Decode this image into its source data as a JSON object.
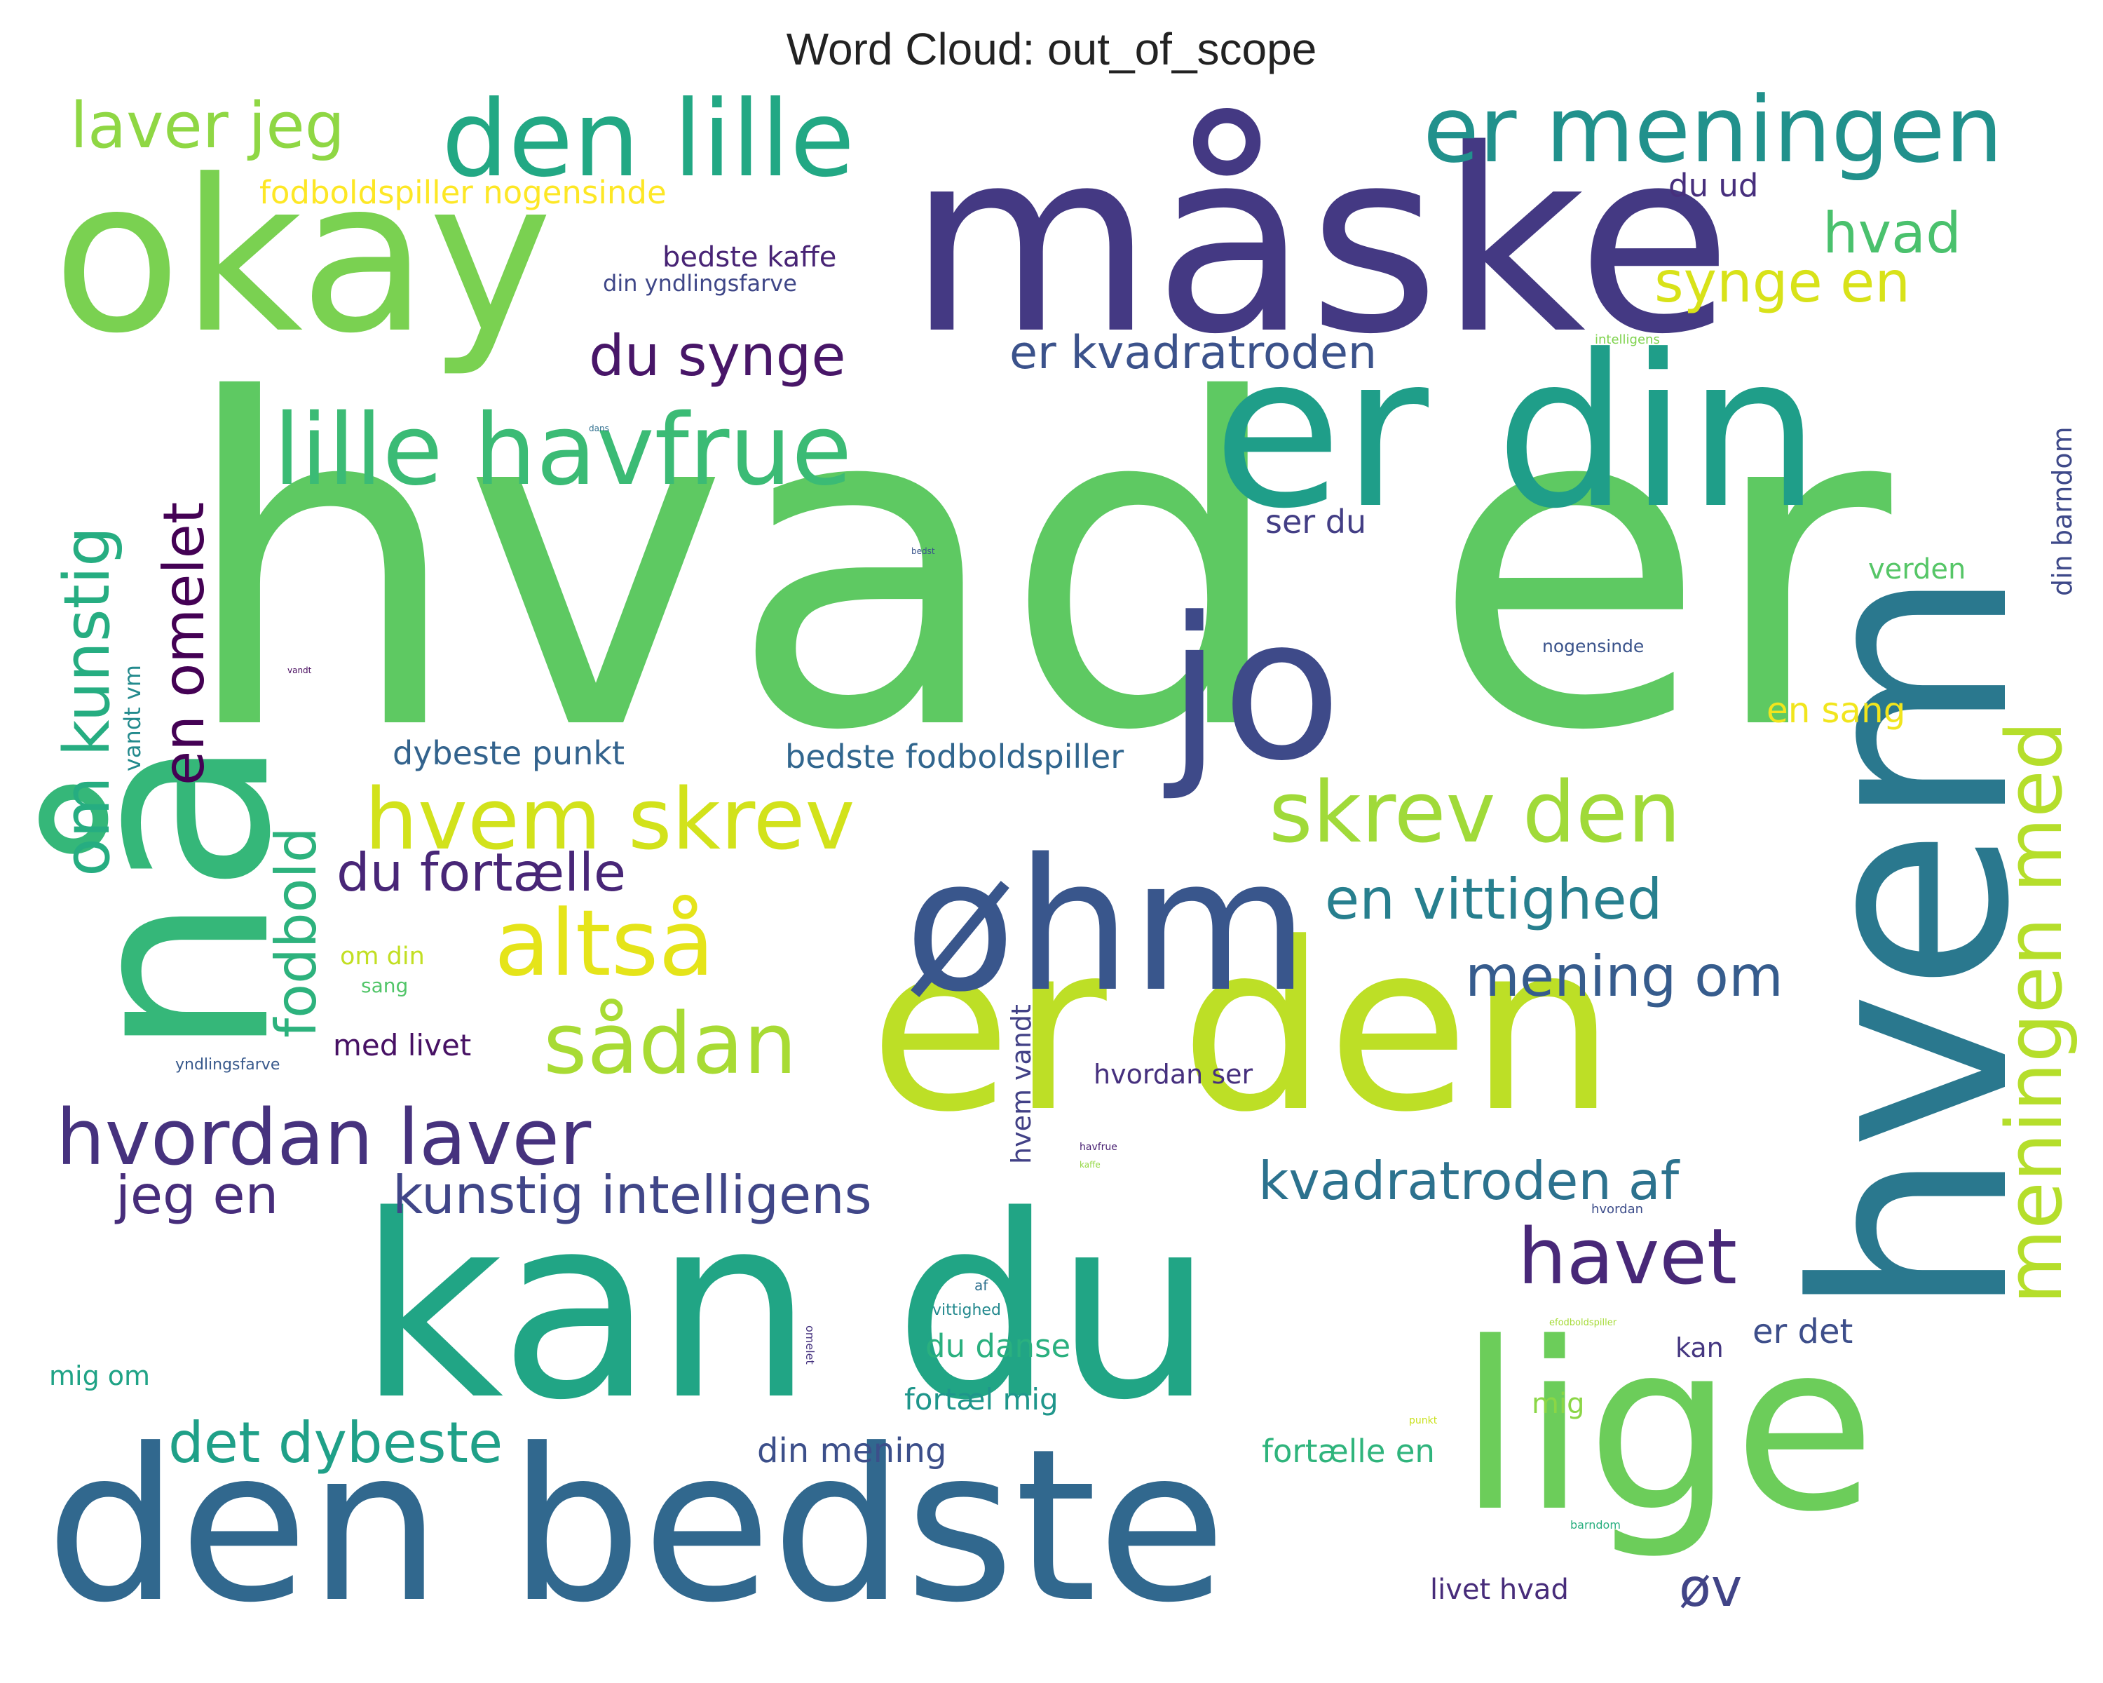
{
  "title": "Word Cloud: out_of_scope",
  "words": [
    {
      "text": "hvad er",
      "color": "#5ec962"
    },
    {
      "text": "måske",
      "color": "#443983"
    },
    {
      "text": "okay",
      "color": "#7ad151"
    },
    {
      "text": "er din",
      "color": "#1f9e89"
    },
    {
      "text": "kan du",
      "color": "#21a585"
    },
    {
      "text": "den bedste",
      "color": "#31688e"
    },
    {
      "text": "er den",
      "color": "#bddf26"
    },
    {
      "text": "hvem",
      "color": "#2a788e"
    },
    {
      "text": "lige",
      "color": "#6ccd5a"
    },
    {
      "text": "nå",
      "color": "#35b779"
    },
    {
      "text": "jo",
      "color": "#3e4a89"
    },
    {
      "text": "øhm",
      "color": "#39568c"
    },
    {
      "text": "den lille",
      "color": "#22a884"
    },
    {
      "text": "er meningen",
      "color": "#21918c"
    },
    {
      "text": "lille havfrue",
      "color": "#3bbb75"
    },
    {
      "text": "hvem skrev",
      "color": "#d2e21b"
    },
    {
      "text": "skrev den",
      "color": "#a0da39"
    },
    {
      "text": "altså",
      "color": "#e5e419"
    },
    {
      "text": "sådan",
      "color": "#a8db34"
    },
    {
      "text": "hvordan laver",
      "color": "#46327e"
    },
    {
      "text": "meningen med",
      "color": "#b5de2b"
    },
    {
      "text": "laver jeg",
      "color": "#8fd744"
    },
    {
      "text": "om kunstig",
      "color": "#26ad81"
    },
    {
      "text": "en omelet",
      "color": "#440154"
    },
    {
      "text": "fodbold",
      "color": "#2db27d"
    },
    {
      "text": "du synge",
      "color": "#481668"
    },
    {
      "text": "synge en",
      "color": "#d8e219"
    },
    {
      "text": "hvad",
      "color": "#4ac16d"
    },
    {
      "text": "er kvadratroden",
      "color": "#3b528b"
    },
    {
      "text": "du fortælle",
      "color": "#482677"
    },
    {
      "text": "en vittighed",
      "color": "#277f8e"
    },
    {
      "text": "mening om",
      "color": "#365c8d"
    },
    {
      "text": "kunstig intelligens",
      "color": "#404688"
    },
    {
      "text": "jeg en",
      "color": "#472d7b"
    },
    {
      "text": "kvadratroden af",
      "color": "#2c728e"
    },
    {
      "text": "havet",
      "color": "#482878"
    },
    {
      "text": "det dybeste",
      "color": "#1fa088"
    },
    {
      "text": "øv",
      "color": "#414487"
    },
    {
      "text": "fodboldspiller nogensinde",
      "color": "#fde725"
    },
    {
      "text": "du ud",
      "color": "#472f7d"
    },
    {
      "text": "bedste kaffe",
      "color": "#482475"
    },
    {
      "text": "din yndlingsfarve",
      "color": "#3f4788"
    },
    {
      "text": "dybeste punkt",
      "color": "#33638d"
    },
    {
      "text": "bedste fodboldspiller",
      "color": "#31668e"
    },
    {
      "text": "ser du",
      "color": "#433e85"
    },
    {
      "text": "verden",
      "color": "#56c667"
    },
    {
      "text": "din barndom",
      "color": "#3e4989"
    },
    {
      "text": "nogensinde",
      "color": "#3a538b"
    },
    {
      "text": "en sang",
      "color": "#f1e51d"
    },
    {
      "text": "vandt vm",
      "color": "#238a8d"
    },
    {
      "text": "om din",
      "color": "#c2df23"
    },
    {
      "text": "sang",
      "color": "#52c569"
    },
    {
      "text": "med livet",
      "color": "#471164"
    },
    {
      "text": "yndlingsfarve",
      "color": "#38598c"
    },
    {
      "text": "hvem vandt",
      "color": "#424186"
    },
    {
      "text": "hvordan ser",
      "color": "#46307e"
    },
    {
      "text": "du danse",
      "color": "#2ab07f"
    },
    {
      "text": "fortæl mig",
      "color": "#1f968b"
    },
    {
      "text": "din mening",
      "color": "#3c4f8a"
    },
    {
      "text": "fortælle en",
      "color": "#2fb47c"
    },
    {
      "text": "mig om",
      "color": "#20a386"
    },
    {
      "text": "vittighed",
      "color": "#23898e"
    },
    {
      "text": "omelet",
      "color": "#46337f"
    },
    {
      "text": "kan",
      "color": "#453781"
    },
    {
      "text": "er det",
      "color": "#3d4e8a"
    },
    {
      "text": "mig",
      "color": "#8bd646"
    },
    {
      "text": "livet hvad",
      "color": "#472c7a"
    },
    {
      "text": "intelligens",
      "color": "#7fd34e"
    },
    {
      "text": "dans",
      "color": "#2e6e8e"
    },
    {
      "text": "bedst",
      "color": "#3a548c"
    },
    {
      "text": "vandt",
      "color": "#460a5d"
    },
    {
      "text": "havfrue",
      "color": "#482071"
    },
    {
      "text": "kaffe",
      "color": "#93d741"
    },
    {
      "text": "hvordan",
      "color": "#3d4d8a"
    },
    {
      "text": "af",
      "color": "#2d708e"
    },
    {
      "text": "efodboldspiller",
      "color": "#a5db36"
    },
    {
      "text": "punkt",
      "color": "#cae11f"
    },
    {
      "text": "barndom",
      "color": "#29af7f"
    }
  ]
}
